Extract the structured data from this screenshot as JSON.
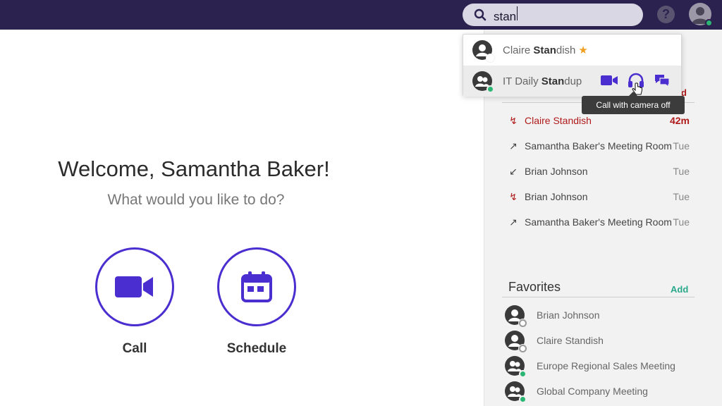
{
  "search": {
    "value": "stan"
  },
  "header": {
    "help_label": "?"
  },
  "main": {
    "welcome": "Welcome, Samantha Baker!",
    "subtitle": "What would you like to do?",
    "actions": [
      {
        "label": "Call",
        "icon": "video-camera-icon"
      },
      {
        "label": "Schedule",
        "icon": "calendar-icon"
      }
    ]
  },
  "dropdown": {
    "items": [
      {
        "pre": "Claire ",
        "bold": "Stan",
        "post": "dish",
        "status": "offline",
        "favorite": true,
        "star": "★"
      },
      {
        "pre": "IT Daily ",
        "bold": "Stan",
        "post": "dup",
        "status": "online",
        "group": true
      }
    ],
    "tooltip": "Call with camera off"
  },
  "history": {
    "peek_label": "d",
    "items": [
      {
        "name": "Claire Standish",
        "time": "42m",
        "type": "missed",
        "arrow": "↯"
      },
      {
        "name": "Samantha Baker's Meeting Room",
        "time": "Tue",
        "type": "outgoing",
        "arrow": "↗"
      },
      {
        "name": "Brian Johnson",
        "time": "Tue",
        "type": "incoming",
        "arrow": "↙"
      },
      {
        "name": "Brian Johnson",
        "time": "Tue",
        "type": "missed",
        "arrow": "↯"
      },
      {
        "name": "Samantha Baker's Meeting Room",
        "time": "Tue",
        "type": "outgoing",
        "arrow": "↗"
      }
    ]
  },
  "favorites": {
    "title": "Favorites",
    "add_label": "Add",
    "items": [
      {
        "name": "Brian Johnson",
        "status": "offline"
      },
      {
        "name": "Claire Standish",
        "status": "offline"
      },
      {
        "name": "Europe Regional Sales Meeting",
        "status": "online",
        "group": true
      },
      {
        "name": "Global Company Meeting",
        "status": "online",
        "group": true
      }
    ]
  },
  "colors": {
    "topbar": "#2c2250",
    "accent": "#4b2ed0",
    "missed": "#b01a1a",
    "online": "#2bb673",
    "add": "#2aa88a"
  }
}
